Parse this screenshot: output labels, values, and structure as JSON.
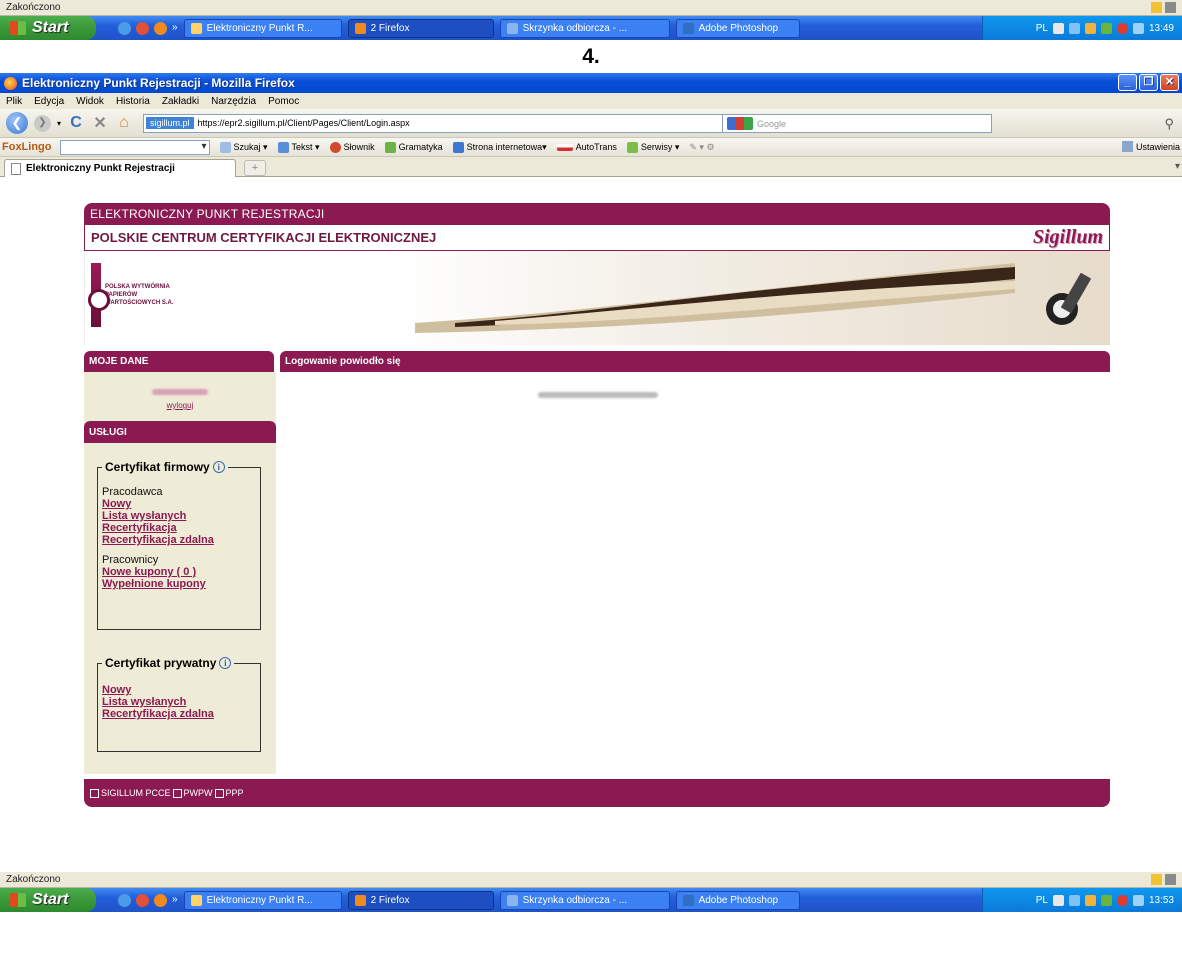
{
  "status_top": "Zakończono",
  "status_bottom": "Zakończono",
  "taskbar": {
    "start": "Start",
    "tasks": [
      "Elektroniczny Punkt R...",
      "2 Firefox",
      "Skrzynka odbiorcza - ...",
      "Adobe Photoshop"
    ],
    "lang": "PL",
    "time_top": "13:49",
    "time_bottom": "13:53"
  },
  "step_label": "4.",
  "window": {
    "title": "Elektroniczny Punkt Rejestracji - Mozilla Firefox",
    "menu": [
      "Plik",
      "Edycja",
      "Widok",
      "Historia",
      "Zakładki",
      "Narzędzia",
      "Pomoc"
    ],
    "identity": "sigillum.pl",
    "url": "https://epr2.sigillum.pl/Client/Pages/Client/Login.aspx",
    "search_placeholder": "Google",
    "foxlingo": "FoxLingo",
    "foxlingo_buttons": [
      "Szukaj ▾",
      "Tekst ▾",
      "Słownik",
      "Gramatyka",
      "Strona internetowa▾",
      "AutoTrans",
      "Serwisy ▾"
    ],
    "settings": "Ustawienia",
    "tab": "Elektroniczny Punkt Rejestracji"
  },
  "site": {
    "header1": "ELEKTRONICZNY PUNKT REJESTRACJI",
    "header2": "POLSKIE CENTRUM CERTYFIKACJI ELEKTRONICZNEJ",
    "brand": "Sigillum",
    "logo_text": "POLSKA WYTWÓRNIA PAPIERÓW WARTOŚCIOWYCH S.A.",
    "left_header": "MOJE DANE",
    "right_header": "Logowanie powiodło się",
    "logout": "wyloguj",
    "services_header": "USŁUGI",
    "firm": {
      "legend": "Certyfikat firmowy",
      "employer": "Pracodawca",
      "employer_links": [
        "Nowy",
        "Lista wysłanych",
        "Recertyfikacja",
        "Recertyfikacja zdalna"
      ],
      "employees": "Pracownicy",
      "employee_links": [
        "Nowe kupony ( 0 )",
        "Wypełnione kupony"
      ]
    },
    "private": {
      "legend": "Certyfikat prywatny",
      "links": [
        "Nowy",
        "Lista wysłanych",
        "Recertyfikacja zdalna"
      ]
    },
    "footer": [
      "SIGILLUM PCCE",
      "PWPW",
      "PPP"
    ]
  }
}
